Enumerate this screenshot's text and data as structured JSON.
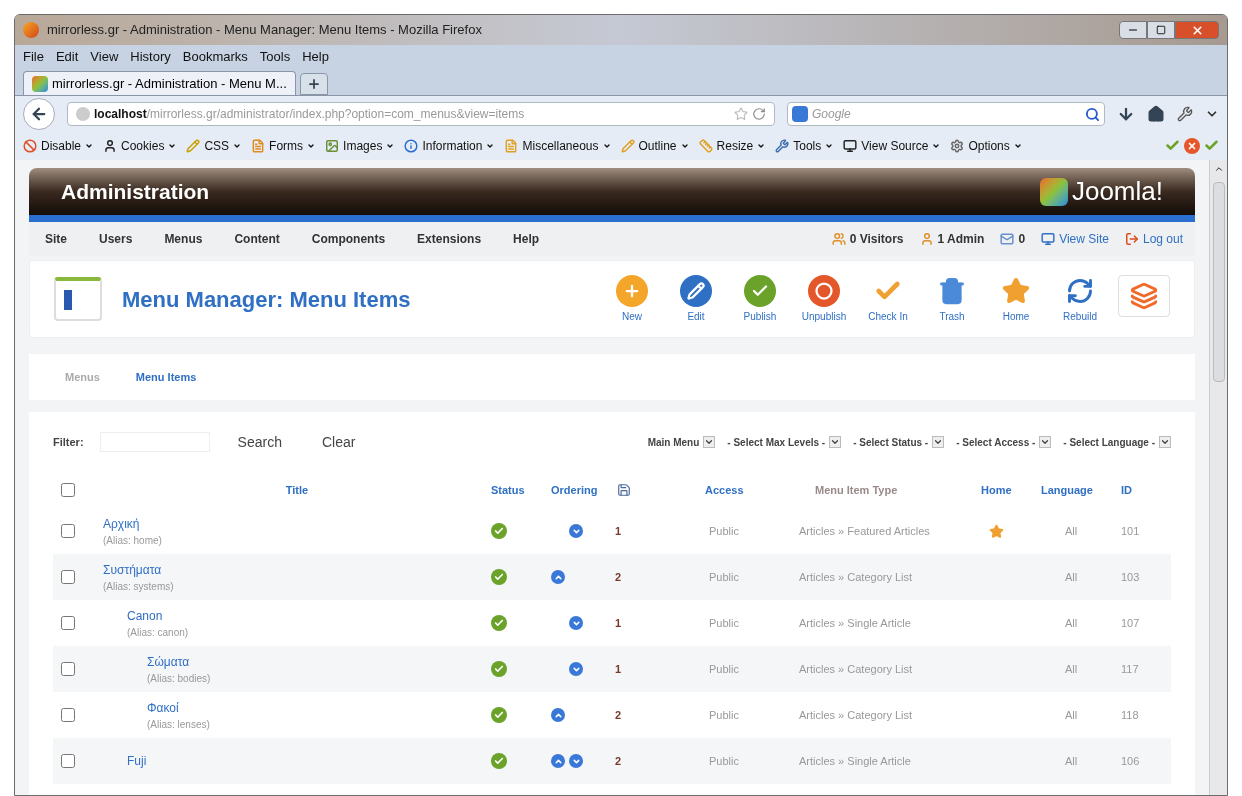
{
  "window": {
    "title": "mirrorless.gr - Administration - Menu Manager: Menu Items - Mozilla Firefox"
  },
  "menu_bar": [
    "File",
    "Edit",
    "View",
    "History",
    "Bookmarks",
    "Tools",
    "Help"
  ],
  "tabs": [
    {
      "label": "mirrorless.gr - Administration - Menu M...",
      "selected": true
    }
  ],
  "address_bar": {
    "host": "localhost",
    "path": "/mirrorless.gr/administrator/index.php?option=com_menus&view=items"
  },
  "search": {
    "placeholder": "Google"
  },
  "dev_toolbar": [
    {
      "kind": "disable",
      "label": "Disable"
    },
    {
      "kind": "cookies",
      "label": "Cookies"
    },
    {
      "kind": "css",
      "label": "CSS"
    },
    {
      "kind": "forms",
      "label": "Forms"
    },
    {
      "kind": "images",
      "label": "Images"
    },
    {
      "kind": "information",
      "label": "Information"
    },
    {
      "kind": "misc",
      "label": "Miscellaneous"
    },
    {
      "kind": "outline",
      "label": "Outline"
    },
    {
      "kind": "resize",
      "label": "Resize"
    },
    {
      "kind": "tools",
      "label": "Tools"
    },
    {
      "kind": "source",
      "label": "View Source"
    },
    {
      "kind": "options",
      "label": "Options"
    }
  ],
  "header": {
    "title": "Administration",
    "logo": "Joomla!"
  },
  "admin_menu": [
    "Site",
    "Users",
    "Menus",
    "Content",
    "Components",
    "Extensions",
    "Help"
  ],
  "status_items": [
    {
      "kind": "visitors",
      "label": "0 Visitors"
    },
    {
      "kind": "admin",
      "label": "1 Admin"
    },
    {
      "kind": "messages",
      "label": "0"
    },
    {
      "kind": "site",
      "label": "View Site"
    },
    {
      "kind": "logout",
      "label": "Log out"
    }
  ],
  "page_title": "Menu Manager: Menu Items",
  "toolbar": [
    {
      "kind": "new",
      "label": "New"
    },
    {
      "kind": "edit",
      "label": "Edit"
    },
    {
      "kind": "publish",
      "label": "Publish"
    },
    {
      "kind": "unpublish",
      "label": "Unpublish"
    },
    {
      "kind": "checkin",
      "label": "Check In"
    },
    {
      "kind": "trash",
      "label": "Trash"
    },
    {
      "kind": "home",
      "label": "Home"
    },
    {
      "kind": "rebuild",
      "label": "Rebuild"
    },
    {
      "kind": "help"
    }
  ],
  "sub_tabs": [
    {
      "label": "Menus",
      "selected": false
    },
    {
      "label": "Menu Items",
      "selected": true
    }
  ],
  "filter": {
    "label": "Filter:",
    "buttons": [
      "Search",
      "Clear"
    ],
    "selects": [
      "Main Menu",
      "- Select Max Levels -",
      "- Select Status -",
      "- Select Access -",
      "- Select Language -"
    ]
  },
  "table": {
    "select_all_checked": false,
    "columns": [
      "Title",
      "Status",
      "Ordering",
      "Access",
      "Menu Item Type",
      "Home",
      "Language",
      "ID"
    ],
    "rows": [
      {
        "title": "Αρχική",
        "alias": "(Alias: home)",
        "checked": false,
        "published": true,
        "order_up": false,
        "order_down": true,
        "order": "1",
        "access": "Public",
        "type": "Articles » Featured Articles",
        "home": true,
        "language": "All",
        "id": "101"
      },
      {
        "title": "Συστήματα",
        "alias": "(Alias: systems)",
        "checked": false,
        "published": true,
        "order_up": true,
        "order_down": false,
        "order": "2",
        "access": "Public",
        "type": "Articles » Category List",
        "home": false,
        "language": "All",
        "id": "103",
        "children": [
          {
            "title": "Canon",
            "alias": "(Alias: canon)",
            "checked": false,
            "published": true,
            "order_up": false,
            "order_down": true,
            "order": "1",
            "access": "Public",
            "type": "Articles » Single Article",
            "home": false,
            "language": "All",
            "id": "107",
            "children": [
              {
                "title": "Σώματα",
                "alias": "(Alias: bodies)",
                "checked": false,
                "published": true,
                "order_up": false,
                "order_down": true,
                "order": "1",
                "access": "Public",
                "type": "Articles » Category List",
                "home": false,
                "language": "All",
                "id": "117"
              },
              {
                "title": "Φακοί",
                "alias": "(Alias: lenses)",
                "checked": false,
                "published": true,
                "order_up": true,
                "order_down": false,
                "order": "2",
                "access": "Public",
                "type": "Articles » Category List",
                "home": false,
                "language": "All",
                "id": "118"
              }
            ]
          },
          {
            "title": "Fuji",
            "checked": false,
            "published": true,
            "order_up": true,
            "order_down": true,
            "order": "2",
            "access": "Public",
            "type": "Articles » Single Article",
            "home": false,
            "language": "All",
            "id": "106"
          }
        ]
      }
    ]
  }
}
